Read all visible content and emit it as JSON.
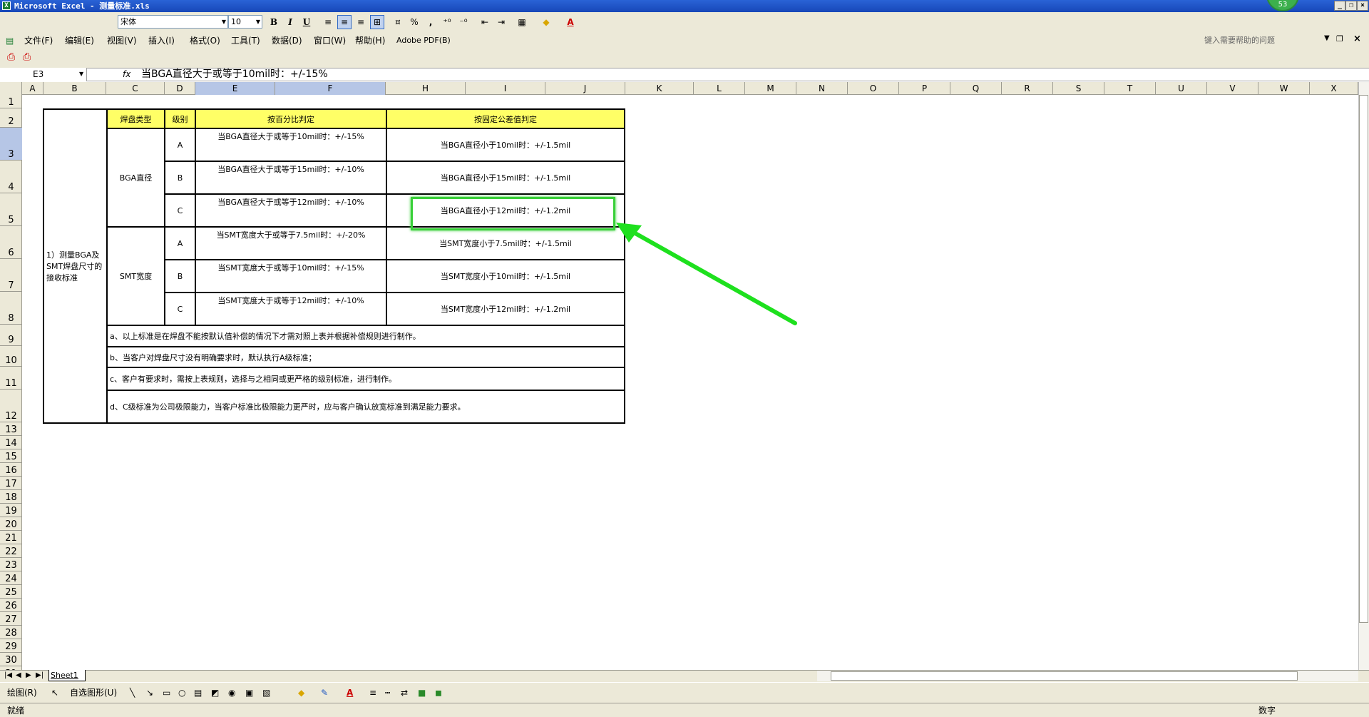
{
  "window": {
    "title": "Microsoft Excel - 测量标准.xls",
    "badge": "53"
  },
  "format_toolbar": {
    "font": "宋体",
    "size": "10",
    "bold": "B",
    "italic": "I",
    "underline": "U",
    "percent": "%",
    "comma": ","
  },
  "menu": [
    "文件(F)",
    "编辑(E)",
    "视图(V)",
    "插入(I)",
    "格式(O)",
    "工具(T)",
    "数据(D)",
    "窗口(W)",
    "帮助(H)",
    "Adobe PDF(B)"
  ],
  "help_placeholder": "键入需要帮助的问题",
  "formula_bar": {
    "name_box": "E3",
    "fx": "fx",
    "content": "当BGA直径大于或等于10mil时：+/-15%"
  },
  "columns": [
    "A",
    "B",
    "C",
    "D",
    "E",
    "F",
    "H",
    "I",
    "J",
    "K",
    "L",
    "M",
    "N",
    "O",
    "P",
    "Q",
    "R",
    "S",
    "T",
    "U",
    "V",
    "W",
    "X"
  ],
  "rows": [
    "1",
    "2",
    "3",
    "4",
    "5",
    "6",
    "7",
    "8",
    "9",
    "10",
    "11",
    "12",
    "13",
    "14",
    "15",
    "16",
    "17",
    "18",
    "19",
    "20",
    "21",
    "22",
    "23",
    "24",
    "25",
    "26",
    "27",
    "28",
    "29",
    "30",
    "31"
  ],
  "table": {
    "header": {
      "pad_type": "焊盘类型",
      "level": "级别",
      "percent": "按百分比判定",
      "fixed": "按固定公差值判定"
    },
    "title_cell": "1）测量BGA及SMT焊盘尺寸的接收标准",
    "bga_label": "BGA直径",
    "smt_label": "SMT宽度",
    "bga_rows": [
      {
        "level": "A",
        "percent": "当BGA直径大于或等于10mil时：+/-15%",
        "fixed": "当BGA直径小于10mil时：+/-1.5mil"
      },
      {
        "level": "B",
        "percent": "当BGA直径大于或等于15mil时：+/-10%",
        "fixed": "当BGA直径小于15mil时：+/-1.5mil"
      },
      {
        "level": "C",
        "percent": "当BGA直径大于或等于12mil时：+/-10%",
        "fixed": "当BGA直径小于12mil时：+/-1.2mil"
      }
    ],
    "smt_rows": [
      {
        "level": "A",
        "percent": "当SMT宽度大于或等于7.5mil时：+/-20%",
        "fixed": "当SMT宽度小于7.5mil时：+/-1.5mil"
      },
      {
        "level": "B",
        "percent": "当SMT宽度大于或等于10mil时：+/-15%",
        "fixed": "当SMT宽度小于10mil时：+/-1.5mil"
      },
      {
        "level": "C",
        "percent": "当SMT宽度大于或等于12mil时：+/-10%",
        "fixed": "当SMT宽度小于12mil时：+/-1.2mil"
      }
    ],
    "notes": [
      "a、以上标准是在焊盘不能按默认值补偿的情况下才需对照上表并根据补偿规则进行制作。",
      "b、当客户对焊盘尺寸没有明确要求时，默认执行A级标准；",
      "c、客户有要求时，需按上表规则，选择与之相同或更严格的级别标准，进行制作。",
      "d、C级标准为公司极限能力，当客户标准比极限能力更严时，应与客户确认放宽标准到满足能力要求。"
    ]
  },
  "sheet_tab": "Sheet1",
  "drawing_toolbar": {
    "draw": "绘图(R)",
    "autoshapes": "自选图形(U)"
  },
  "status": {
    "left": "就绪",
    "right": "数字"
  },
  "colors": {
    "header_fill": "#ffff66",
    "highlight": "#39d039",
    "title_bar": "#2a63d6"
  }
}
